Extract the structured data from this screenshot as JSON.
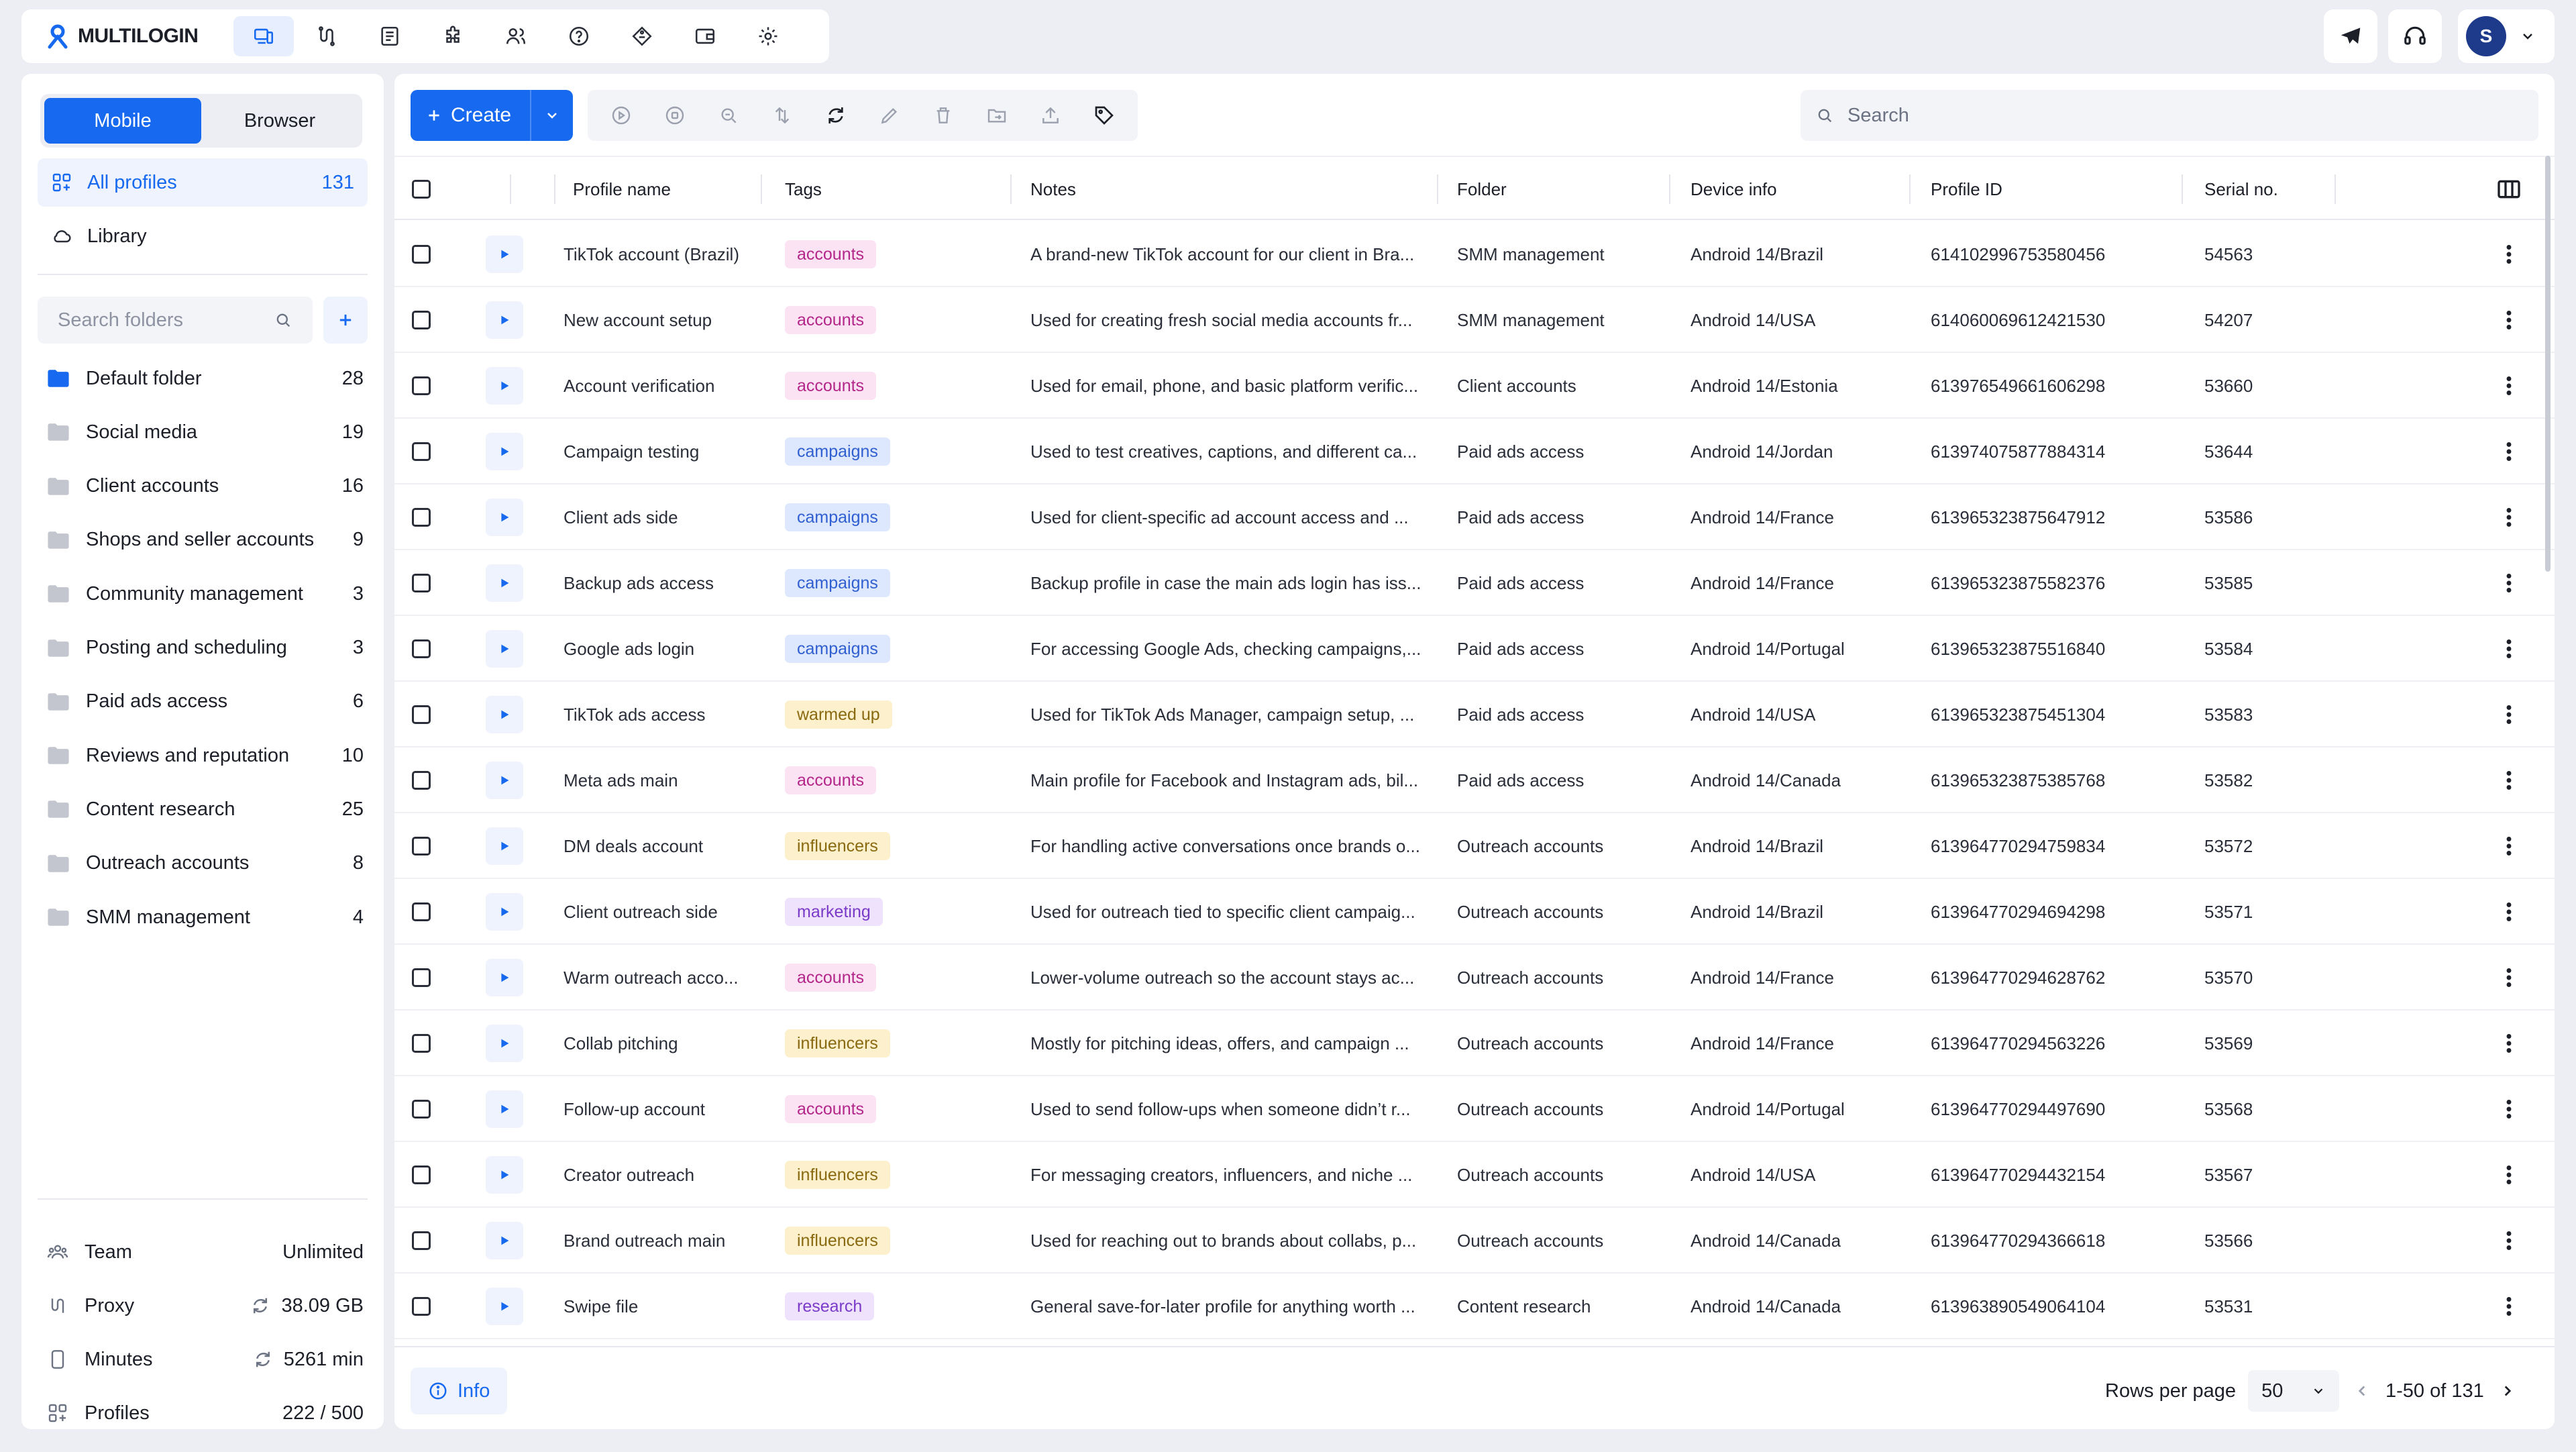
{
  "app": {
    "name": "MULTILOGIN",
    "brand_color": "#1769f0"
  },
  "topnav": {
    "icons": [
      "devices-icon",
      "proxy-icon",
      "logs-icon",
      "extensions-icon",
      "team-icon",
      "help-icon",
      "tag-icon",
      "wallet-icon",
      "settings-icon"
    ],
    "active": "devices-icon"
  },
  "user": {
    "initial": "S"
  },
  "sidebar": {
    "tabs": {
      "mobile": "Mobile",
      "browser": "Browser",
      "active": "Mobile"
    },
    "all_profiles": {
      "label": "All profiles",
      "count": "131"
    },
    "library": {
      "label": "Library"
    },
    "search_placeholder": "Search folders",
    "folders": [
      {
        "name": "Default folder",
        "count": "28"
      },
      {
        "name": "Social media",
        "count": "19"
      },
      {
        "name": "Client accounts",
        "count": "16"
      },
      {
        "name": "Shops and seller accounts",
        "count": "9"
      },
      {
        "name": "Community management",
        "count": "3"
      },
      {
        "name": "Posting and scheduling",
        "count": "3"
      },
      {
        "name": "Paid ads access",
        "count": "6"
      },
      {
        "name": "Reviews and reputation",
        "count": "10"
      },
      {
        "name": "Content research",
        "count": "25"
      },
      {
        "name": "Outreach accounts",
        "count": "8"
      },
      {
        "name": "SMM management",
        "count": "4"
      }
    ],
    "stats": {
      "team": {
        "label": "Team",
        "value": "Unlimited"
      },
      "proxy": {
        "label": "Proxy",
        "value": "38.09 GB"
      },
      "minutes": {
        "label": "Minutes",
        "value": "5261 min"
      },
      "profiles": {
        "label": "Profiles",
        "value": "222 / 500"
      }
    }
  },
  "toolbar": {
    "create_label": "Create",
    "search_placeholder": "Search"
  },
  "table": {
    "columns": {
      "profile_name": "Profile name",
      "tags": "Tags",
      "notes": "Notes",
      "folder": "Folder",
      "device_info": "Device info",
      "profile_id": "Profile ID",
      "serial": "Serial no."
    },
    "tag_colors": {
      "accounts": {
        "bg": "#fce3f3",
        "fg": "#b3268a"
      },
      "campaigns": {
        "bg": "#dde7fd",
        "fg": "#2f5fd0"
      },
      "warmed up": {
        "bg": "#fdf0cc",
        "fg": "#8a6a10"
      },
      "influencers": {
        "bg": "#fdf0cc",
        "fg": "#8a6a10"
      },
      "marketing": {
        "bg": "#efe2fd",
        "fg": "#7a3bc8"
      },
      "research": {
        "bg": "#efe2fd",
        "fg": "#7a3bc8"
      }
    },
    "rows": [
      {
        "name": "TikTok account (Brazil)",
        "tag": "accounts",
        "notes": "A brand-new TikTok account for our client in Bra...",
        "folder": "SMM management",
        "device": "Android 14/Brazil",
        "id": "614102996753580456",
        "serial": "54563"
      },
      {
        "name": "New account setup",
        "tag": "accounts",
        "notes": "Used for creating fresh social media accounts fr...",
        "folder": "SMM management",
        "device": "Android 14/USA",
        "id": "614060069612421530",
        "serial": "54207"
      },
      {
        "name": "Account verification",
        "tag": "accounts",
        "notes": "Used for email, phone, and basic platform verific...",
        "folder": "Client accounts",
        "device": "Android 14/Estonia",
        "id": "613976549661606298",
        "serial": "53660"
      },
      {
        "name": "Campaign testing",
        "tag": "campaigns",
        "notes": "Used to test creatives, captions, and different ca...",
        "folder": "Paid ads access",
        "device": "Android 14/Jordan",
        "id": "613974075877884314",
        "serial": "53644"
      },
      {
        "name": "Client ads side",
        "tag": "campaigns",
        "notes": "Used for client-specific ad account access and ...",
        "folder": "Paid ads access",
        "device": "Android 14/France",
        "id": "613965323875647912",
        "serial": "53586"
      },
      {
        "name": "Backup ads access",
        "tag": "campaigns",
        "notes": "Backup profile in case the main ads login has iss...",
        "folder": "Paid ads access",
        "device": "Android 14/France",
        "id": "613965323875582376",
        "serial": "53585"
      },
      {
        "name": "Google ads login",
        "tag": "campaigns",
        "notes": "For accessing Google Ads, checking campaigns,...",
        "folder": "Paid ads access",
        "device": "Android 14/Portugal",
        "id": "613965323875516840",
        "serial": "53584"
      },
      {
        "name": "TikTok ads access",
        "tag": "warmed up",
        "notes": "Used for TikTok Ads Manager, campaign setup, ...",
        "folder": "Paid ads access",
        "device": "Android 14/USA",
        "id": "613965323875451304",
        "serial": "53583"
      },
      {
        "name": "Meta ads main",
        "tag": "accounts",
        "notes": "Main profile for Facebook and Instagram ads, bil...",
        "folder": "Paid ads access",
        "device": "Android 14/Canada",
        "id": "613965323875385768",
        "serial": "53582"
      },
      {
        "name": "DM deals account",
        "tag": "influencers",
        "notes": "For handling active conversations once brands o...",
        "folder": "Outreach accounts",
        "device": "Android 14/Brazil",
        "id": "613964770294759834",
        "serial": "53572"
      },
      {
        "name": "Client outreach side",
        "tag": "marketing",
        "notes": "Used for outreach tied to specific client campaig...",
        "folder": "Outreach accounts",
        "device": "Android 14/Brazil",
        "id": "613964770294694298",
        "serial": "53571"
      },
      {
        "name": "Warm outreach acco...",
        "tag": "accounts",
        "notes": "Lower-volume outreach so the account stays ac...",
        "folder": "Outreach accounts",
        "device": "Android 14/France",
        "id": "613964770294628762",
        "serial": "53570"
      },
      {
        "name": "Collab pitching",
        "tag": "influencers",
        "notes": "Mostly for pitching ideas, offers, and campaign ...",
        "folder": "Outreach accounts",
        "device": "Android 14/France",
        "id": "613964770294563226",
        "serial": "53569"
      },
      {
        "name": "Follow-up account",
        "tag": "accounts",
        "notes": "Used to send follow-ups when someone didn’t r...",
        "folder": "Outreach accounts",
        "device": "Android 14/Portugal",
        "id": "613964770294497690",
        "serial": "53568"
      },
      {
        "name": "Creator outreach",
        "tag": "influencers",
        "notes": "For messaging creators, influencers, and niche ...",
        "folder": "Outreach accounts",
        "device": "Android 14/USA",
        "id": "613964770294432154",
        "serial": "53567"
      },
      {
        "name": "Brand outreach main",
        "tag": "influencers",
        "notes": "Used for reaching out to brands about collabs, p...",
        "folder": "Outreach accounts",
        "device": "Android 14/Canada",
        "id": "613964770294366618",
        "serial": "53566"
      },
      {
        "name": "Swipe file",
        "tag": "research",
        "notes": "General save-for-later profile for anything worth ...",
        "folder": "Content research",
        "device": "Android 14/Canada",
        "id": "613963890549064104",
        "serial": "53531"
      }
    ]
  },
  "footer": {
    "info_label": "Info",
    "rows_per_page_label": "Rows per page",
    "rows_per_page": "50",
    "range": "1-50 of 131"
  }
}
